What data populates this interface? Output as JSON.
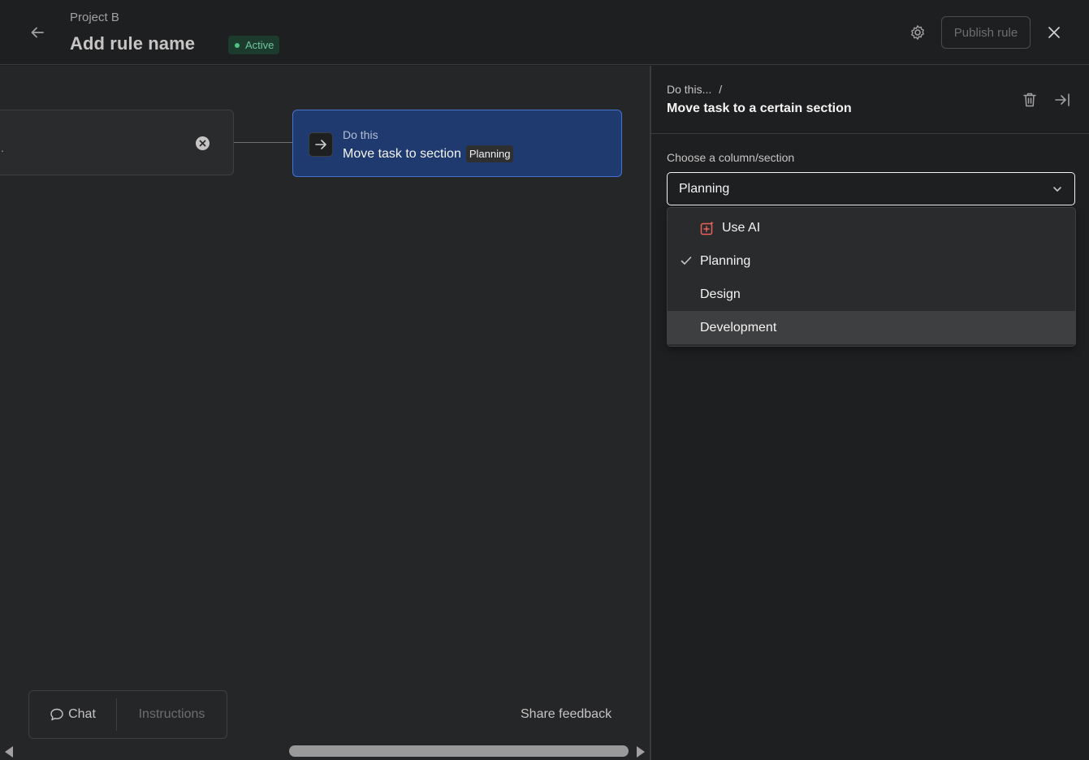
{
  "header": {
    "project_name": "Project B",
    "rule_name": "Add rule name",
    "status": "Active",
    "publish_label": "Publish rule",
    "icons": [
      "back-arrow-icon",
      "gear-icon",
      "close-icon"
    ]
  },
  "canvas": {
    "trigger_text": ".",
    "action": {
      "label": "Do this",
      "text": "Move task to section",
      "section": "Planning"
    },
    "chat_tab": "Chat",
    "instructions_tab": "Instructions",
    "share_feedback": "Share feedback"
  },
  "panel": {
    "breadcrumb": "Do this...",
    "breadcrumb_sep": "/",
    "title": "Move task to a certain section",
    "field_label": "Choose a column/section",
    "selected": "Planning",
    "options": [
      {
        "label": "Use AI",
        "icon": "ai-sparkle-icon"
      },
      {
        "label": "Planning",
        "checked": true
      },
      {
        "label": "Design"
      },
      {
        "label": "Development",
        "highlighted": true
      }
    ]
  },
  "colors": {
    "accent_blue": "#4573d2",
    "action_bg": "#1e3a6e",
    "status_green": "#4ec07f",
    "ai_icon": "#e8615a"
  }
}
